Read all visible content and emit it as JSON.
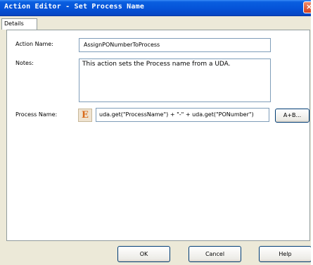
{
  "window": {
    "title": "Action Editor - Set Process Name",
    "close_glyph": "×"
  },
  "tabs": [
    {
      "label": "Details"
    }
  ],
  "form": {
    "action_name_label": "Action Name:",
    "action_name_value": "AssignPONumberToProcess",
    "notes_label": "Notes:",
    "notes_value": "This action sets the Process name from a UDA.",
    "process_name_label": "Process Name:",
    "expression_icon_glyph": "E",
    "process_name_expression": "uda.get(\"ProcessName\") + \"-\" + uda.get(\"PONumber\")",
    "expression_builder_label": "A+B..."
  },
  "footer": {
    "ok_label": "OK",
    "cancel_label": "Cancel",
    "help_label": "Help"
  },
  "colors": {
    "titlebar": "#0553d8",
    "close_button": "#d4421e",
    "expression_icon": "#d96a1a",
    "dialog_bg": "#ece9d8"
  }
}
